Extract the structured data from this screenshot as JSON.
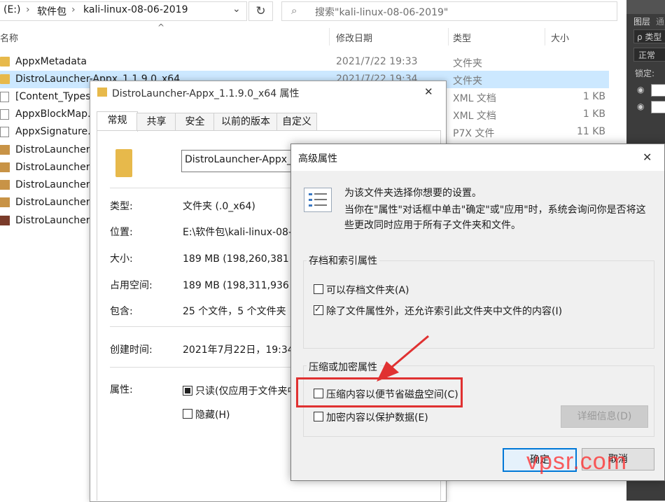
{
  "explorer": {
    "breadcrumb": {
      "drive": "(E:)",
      "sep": "›",
      "folder1": "软件包",
      "folder2": "kali-linux-08-06-2019",
      "dropdown": "⌄"
    },
    "search_placeholder": "搜索\"kali-linux-08-06-2019\"",
    "columns": {
      "name": "名称",
      "date": "修改日期",
      "type": "类型",
      "size": "大小"
    },
    "files": [
      {
        "name": "AppxMetadata",
        "date": "2021/7/22 19:33",
        "type": "文件夹",
        "size": "",
        "icon": "folder-icon"
      },
      {
        "name": "DistroLauncher-Appx_1.1.9.0_x64",
        "date": "2021/7/22 19:34",
        "type": "文件夹",
        "size": "",
        "icon": "folder-icon"
      },
      {
        "name": "[Content_Types",
        "date": "",
        "type": "XML 文档",
        "size": "1 KB",
        "icon": "file-icon"
      },
      {
        "name": "AppxBlockMap.",
        "date": "",
        "type": "XML 文档",
        "size": "1 KB",
        "icon": "file-icon"
      },
      {
        "name": "AppxSignature.",
        "date": "",
        "type": "P7X 文件",
        "size": "11 KB",
        "icon": "file-icon"
      },
      {
        "name": "DistroLauncher-",
        "date": "",
        "type": "",
        "size": "",
        "icon": "package-icon"
      },
      {
        "name": "DistroLauncher-",
        "date": "",
        "type": "",
        "size": "",
        "icon": "package-icon"
      },
      {
        "name": "DistroLauncher-",
        "date": "",
        "type": "",
        "size": "",
        "icon": "package-icon"
      },
      {
        "name": "DistroLauncher-",
        "date": "",
        "type": "",
        "size": "",
        "icon": "package-icon"
      },
      {
        "name": "DistroLauncher-",
        "date": "",
        "type": "",
        "size": "",
        "icon": "app-icon"
      }
    ]
  },
  "photoshop": {
    "tab1": "图层",
    "tab2": "通",
    "kind": "ρ 类型",
    "mode": "正常",
    "lock": "锁定:"
  },
  "properties": {
    "title": "DistroLauncher-Appx_1.1.9.0_x64 属性",
    "close": "✕",
    "tabs": [
      "常规",
      "共享",
      "安全",
      "以前的版本",
      "自定义"
    ],
    "name_value": "DistroLauncher-Appx_",
    "fields": [
      {
        "label": "类型:",
        "value": "文件夹 (.0_x64)"
      },
      {
        "label": "位置:",
        "value": "E:\\软件包\\kali-linux-08-0"
      },
      {
        "label": "大小:",
        "value": "189 MB (198,260,381 字"
      },
      {
        "label": "占用空间:",
        "value": "189 MB (198,311,936 字"
      },
      {
        "label": "包含:",
        "value": "25 个文件，5 个文件夹"
      },
      {
        "label": "创建时间:",
        "value": "2021年7月22日，19:34:"
      },
      {
        "label": "属性:",
        "value": ""
      }
    ],
    "readonly_label": "只读(仅应用于文件夹中",
    "hidden_label": "隐藏(H)"
  },
  "advanced": {
    "title": "高级属性",
    "close": "✕",
    "intro_line1": "为该文件夹选择你想要的设置。",
    "intro_line2": "当你在\"属性\"对话框中单击\"确定\"或\"应用\"时，系统会询问你是否将这",
    "intro_line3": "些更改同时应用于所有子文件夹和文件。",
    "group1_label": "存档和索引属性",
    "archive_label": "可以存档文件夹(A)",
    "archive_checked": false,
    "index_label": "除了文件属性外，还允许索引此文件夹中文件的内容(I)",
    "index_checked": true,
    "group2_label": "压缩或加密属性",
    "compress_label": "压缩内容以便节省磁盘空间(C)",
    "compress_checked": false,
    "encrypt_label": "加密内容以保护数据(E)",
    "encrypt_checked": false,
    "details_button": "详细信息(D)",
    "ok_button": "确定",
    "cancel_button": "取消",
    "highlight_color": "#e03131"
  },
  "watermark": "vpsr.com"
}
